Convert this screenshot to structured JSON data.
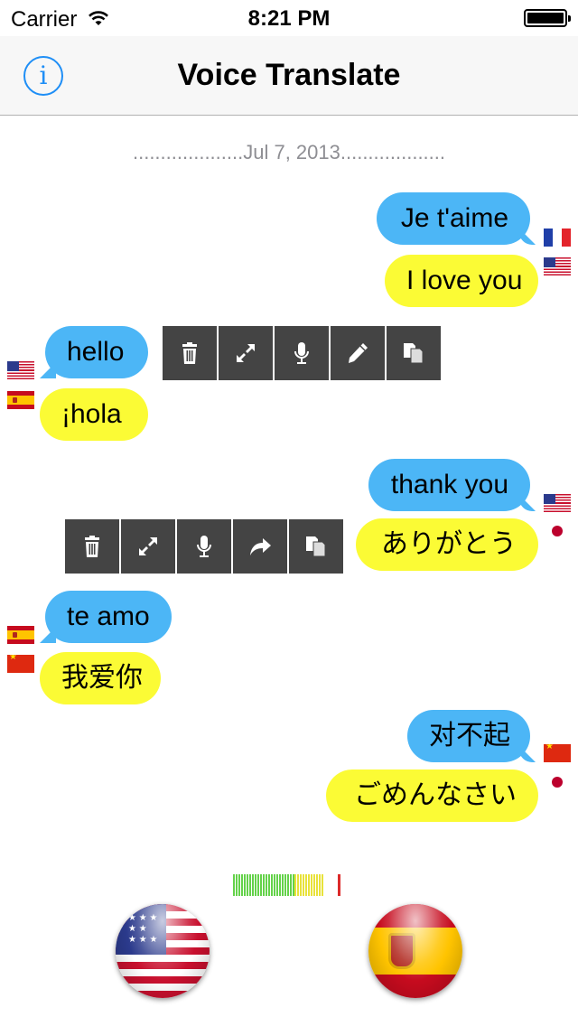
{
  "status_bar": {
    "carrier": "Carrier",
    "time": "8:21 PM"
  },
  "nav": {
    "title": "Voice Translate",
    "info_icon": "info-icon"
  },
  "date_separator": "....................Jul 7, 2013...................",
  "messages": [
    {
      "source": "Je t'aime",
      "source_flag": "france-flag-icon",
      "translation": "I love you",
      "translation_flag": "us-flag-icon",
      "side": "right"
    },
    {
      "source": "hello",
      "source_flag": "us-flag-icon",
      "translation": "¡hola",
      "translation_flag": "spain-flag-icon",
      "side": "left"
    },
    {
      "source": "thank you",
      "source_flag": "us-flag-icon",
      "translation": "ありがとう",
      "translation_flag": "japan-flag-icon",
      "side": "right"
    },
    {
      "source": "te amo",
      "source_flag": "spain-flag-icon",
      "translation": "我爱你",
      "translation_flag": "china-flag-icon",
      "side": "left"
    },
    {
      "source": "对不起",
      "source_flag": "china-flag-icon",
      "translation": "ごめんなさい",
      "translation_flag": "japan-flag-icon",
      "side": "right"
    }
  ],
  "toolbar_1": [
    "trash-icon",
    "expand-icon",
    "microphone-icon",
    "pencil-icon",
    "copy-icon"
  ],
  "toolbar_2": [
    "trash-icon",
    "expand-icon",
    "microphone-icon",
    "forward-icon",
    "copy-icon"
  ],
  "speak_buttons": [
    {
      "language": "English (US)",
      "icon": "us-flag-icon"
    },
    {
      "language": "Spanish",
      "icon": "spain-flag-icon"
    }
  ],
  "colors": {
    "accent": "#1e8ef6",
    "source_bubble": "#4cb6f6",
    "translation_bubble": "#fbfb35",
    "toolbar_bg": "#444444",
    "meter_green": "#64d24a",
    "meter_yellow": "#e8e23a",
    "meter_peak": "#dc2a2a"
  }
}
